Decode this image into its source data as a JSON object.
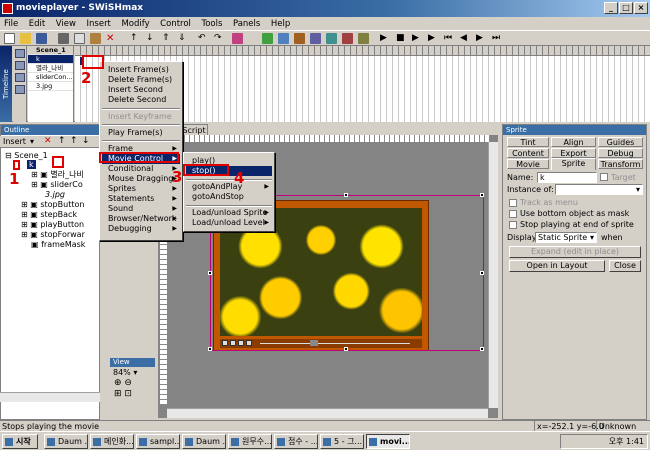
{
  "window": {
    "title": "movieplayer - SWiSHmax",
    "min": "_",
    "max": "□",
    "close": "×"
  },
  "menubar": [
    "File",
    "Edit",
    "View",
    "Insert",
    "Modify",
    "Control",
    "Tools",
    "Panels",
    "Help"
  ],
  "timeline": {
    "label": "Timeline",
    "rows": [
      "Scene_1",
      "k",
      "별라_나비",
      "sliderCon...",
      "3.jpg"
    ]
  },
  "outline": {
    "title": "Outline",
    "items": [
      "Scene_1",
      "k",
      "별라_나비",
      "sliderCo",
      "3.jpg",
      "stopButton",
      "stepBack",
      "playButton",
      "stopForwar",
      "frameMask"
    ],
    "insert_label": "Insert"
  },
  "stage": {
    "script_tab": "Script",
    "view_label": "View",
    "zoom": "84%"
  },
  "context_menu": {
    "items": [
      "Insert Frame(s)",
      "Delete Frame(s)",
      "Insert Second",
      "Delete Second",
      "Insert Keyframe",
      "Play Frame(s)",
      "Frame",
      "Movie Control",
      "Conditional",
      "Mouse Dragging",
      "Sprites",
      "Statements",
      "Sound",
      "Browser/Network",
      "Debugging"
    ]
  },
  "submenu": {
    "items": [
      "play()",
      "stop()",
      "gotoAndPlay",
      "gotoAndStop",
      "Load/unload Sprite",
      "Load/unload Level"
    ]
  },
  "annotations": [
    "1",
    "2",
    "3",
    "4"
  ],
  "sprite_panel": {
    "title": "Sprite",
    "tabs_row1": [
      "Tint",
      "Align",
      "Guides"
    ],
    "tabs_row2": [
      "Content",
      "Export",
      "Debug"
    ],
    "tabs_row3": [
      "Movie",
      "Sprite",
      "Transform"
    ],
    "name_label": "Name:",
    "name_value": "k",
    "target_label": "Target",
    "instance_label": "Instance of:",
    "track_as_menu": "Track as menu",
    "use_bottom_mask": "Use bottom object as mask",
    "stop_playing": "Stop playing at end of sprite",
    "display_label": "Display",
    "display_value": "Static Sprite",
    "when_label": "when",
    "expand_button": "Expand (edit in place)",
    "open_layout_button": "Open in Layout",
    "close_button": "Close"
  },
  "statusbar": {
    "text": "Stops playing the movie",
    "coords": "x=-252.1 y=-6.0",
    "size": "Unknown Size"
  },
  "taskbar": {
    "start": "시작",
    "tasks": [
      "Daum ...",
      "메인화...",
      "sampl...",
      "Daum ...",
      "원무수...",
      "접수 - ...",
      "5 - 그...",
      "movi..."
    ],
    "clock": "오후 1:41"
  },
  "colors": {
    "title_bar": "#0a246a",
    "highlight": "#0a246a",
    "annotation": "#e00000",
    "frame": "#c05800"
  }
}
